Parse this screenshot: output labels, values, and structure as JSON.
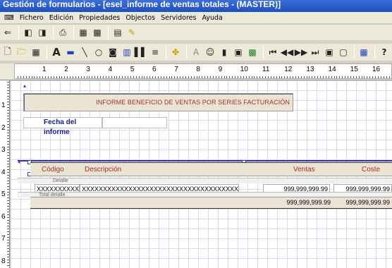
{
  "window": {
    "title": "Gestión de formularios - [esel_informe de ventas totales - (MASTER)]"
  },
  "menu": [
    "Fichero",
    "Edición",
    "Propiedades",
    "Objectos",
    "Servidores",
    "Ayuda"
  ],
  "toolbar1": [
    "app-icon",
    "first-record-icon",
    "last-record-icon",
    "print-icon",
    "save-icon",
    "grid-icon",
    "layout-icon",
    "pencil-icon"
  ],
  "toolbar2": [
    "new-icon",
    "open-icon",
    "save-icon",
    "text-icon",
    "rectangle-icon",
    "line-icon",
    "ellipse-icon",
    "image-icon",
    "chart-icon",
    "barcode-icon",
    "memo-icon",
    "function-icon",
    "font-icon",
    "emoji-icon",
    "trash-icon",
    "copy-icon",
    "paste-icon",
    "first-icon",
    "prev-icon",
    "next-icon",
    "last-icon",
    "view-icon",
    "frame-icon",
    "report-icon",
    "help-icon"
  ],
  "help_label": "?",
  "ruler": {
    "labels": [
      "1",
      "2",
      "3",
      "4",
      "5",
      "6",
      "7",
      "8",
      "9",
      "10",
      "11",
      "12",
      "13",
      "14",
      "15",
      "16"
    ]
  },
  "vruler": {
    "labels": [
      "1",
      "2",
      "3",
      "4",
      "5",
      "6",
      "7",
      "8"
    ]
  },
  "report": {
    "title": "INFORME BENEFICIO DE VENTAS POR SERIES FACTURACIÓN",
    "fecha_label": "Fecha del informe",
    "columns": {
      "codigo": "Código",
      "descripcion": "Descripción",
      "ventas": "Ventas",
      "coste": "Coste"
    },
    "detail_band": "Detalle",
    "total_band": "Total detalle",
    "row": {
      "codigo": "XXXXXXXXXXXX",
      "descripcion": "XXXXXXXXXXXXXXXXXXXXXXXXXXXXXXXXXXXXX",
      "ventas": "999,999,999.99",
      "coste": "999,999,999.99"
    },
    "total": {
      "ventas": "999,999,999.99",
      "coste": "999,999,999.99"
    }
  }
}
